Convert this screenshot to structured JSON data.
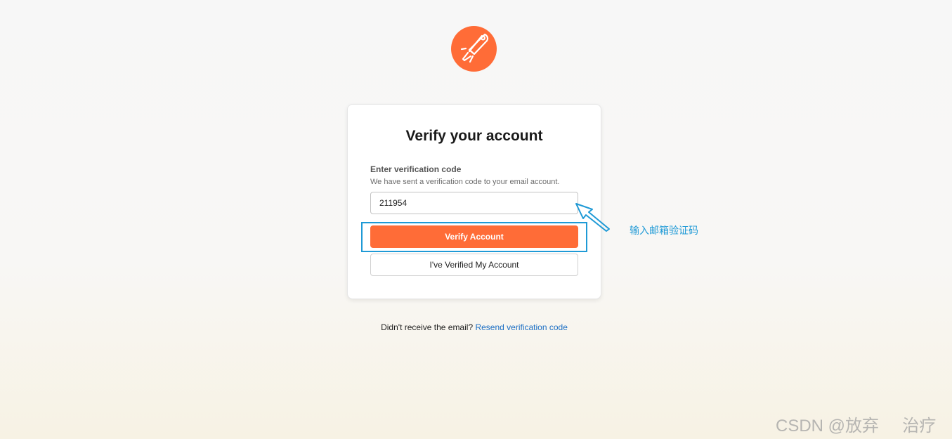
{
  "logo": {
    "icon": "postman-astronaut-logo-icon",
    "color": "#ff6c37"
  },
  "card": {
    "title": "Verify your account",
    "field_label": "Enter verification code",
    "field_help": "We have sent a verification code to your email account.",
    "code_value": "211954",
    "verify_button": "Verify Account",
    "verified_button": "I've Verified My Account"
  },
  "footer": {
    "prompt": "Didn't receive the email?",
    "resend_link": "Resend verification code"
  },
  "annotation": {
    "text": "输入邮箱验证码",
    "color": "#1f9ad6"
  },
  "watermark": "CSDN @放弃     治疗",
  "colors": {
    "accent": "#ff6c37",
    "link": "#1d6fc4"
  }
}
